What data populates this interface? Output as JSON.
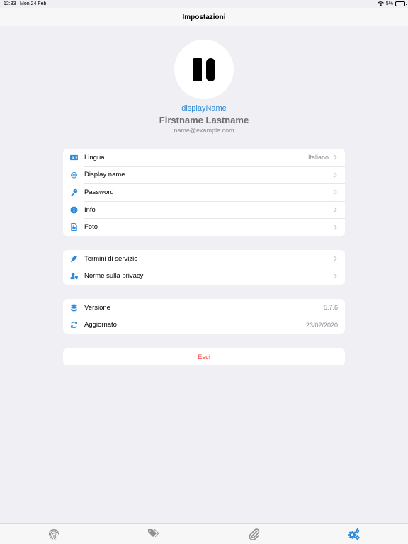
{
  "status_bar": {
    "time": "12:33",
    "date": "Mon 24 Feb",
    "battery": "5%"
  },
  "nav": {
    "title": "Impostazioni"
  },
  "profile": {
    "display_name": "displayName",
    "full_name": "Firstname Lastname",
    "email": "name@example.com"
  },
  "sections": [
    {
      "rows": [
        {
          "icon": "language-icon",
          "label": "Lingua",
          "value": "Italiano"
        },
        {
          "icon": "at-icon",
          "label": "Display name",
          "value": ""
        },
        {
          "icon": "key-icon",
          "label": "Password",
          "value": ""
        },
        {
          "icon": "info-icon",
          "label": "Info",
          "value": ""
        },
        {
          "icon": "photo-file-icon",
          "label": "Foto",
          "value": ""
        }
      ]
    },
    {
      "rows": [
        {
          "icon": "feather-icon",
          "label": "Termini di servizio"
        },
        {
          "icon": "user-shield-icon",
          "label": "Norme sulla privacy"
        }
      ]
    },
    {
      "rows": [
        {
          "icon": "database-icon",
          "label": "Versione",
          "value": "5.7.6"
        },
        {
          "icon": "sync-icon",
          "label": "Aggiornato",
          "value": "23/02/2020"
        }
      ]
    }
  ],
  "logout": {
    "label": "Esci"
  },
  "tab_bar": {
    "tabs": [
      {
        "icon": "fingerprint-icon",
        "active": false
      },
      {
        "icon": "tags-icon",
        "active": false
      },
      {
        "icon": "paperclip-icon",
        "active": false
      },
      {
        "icon": "cogs-icon",
        "active": true
      }
    ]
  },
  "colors": {
    "accent": "#2f8bd9",
    "destructive": "#ff3b30",
    "background": "#efeff4",
    "inactive_tab": "#8e8e93"
  }
}
